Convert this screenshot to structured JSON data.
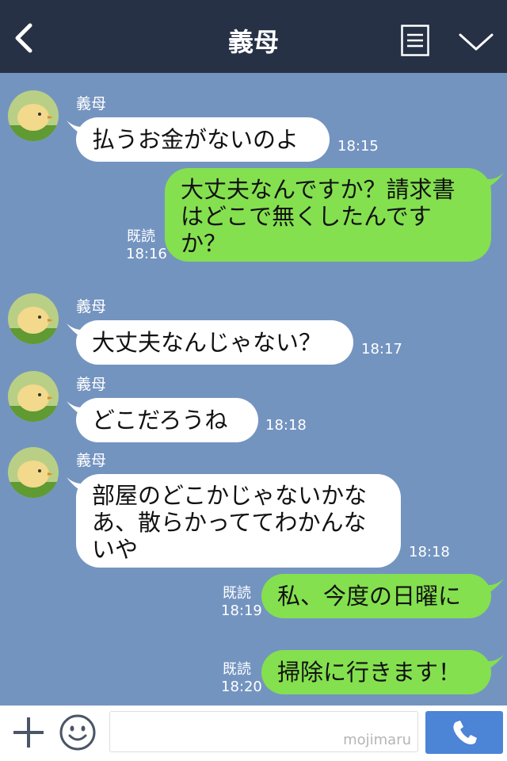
{
  "header": {
    "title": "義母",
    "back_icon": "chevron-left-icon",
    "menu_icon": "list-icon",
    "collapse_icon": "chevron-down-icon",
    "background": "#263146"
  },
  "chat": {
    "background": "#7494c0",
    "messages": [
      {
        "sender": "義母",
        "text": "払うお金がないのよ",
        "time": "18:15"
      },
      {
        "text": "大丈夫なんですか？請求書はどこで無くしたんですか？",
        "read": "既読",
        "time": "18:16"
      },
      {
        "sender": "義母",
        "text": "大丈夫なんじゃない？",
        "time": "18:17"
      },
      {
        "sender": "義母",
        "text": "どこだろうね",
        "time": "18:18"
      },
      {
        "sender": "義母",
        "text": "部屋のどこかじゃないかなあ、散らかっててわかんないや",
        "time": "18:18"
      },
      {
        "text": "私、今度の日曜に",
        "read": "既読",
        "time": "18:19"
      },
      {
        "text": "掃除に行きます！",
        "read": "既読",
        "time": "18:20"
      }
    ]
  },
  "input": {
    "watermark": "mojimaru",
    "plus_icon": "plus-icon",
    "sticker_icon": "smiley-icon",
    "call_icon": "phone-icon",
    "accent": "#4c84d6"
  },
  "colors": {
    "incoming_bubble": "#ffffff",
    "outgoing_bubble": "#84e04f"
  }
}
